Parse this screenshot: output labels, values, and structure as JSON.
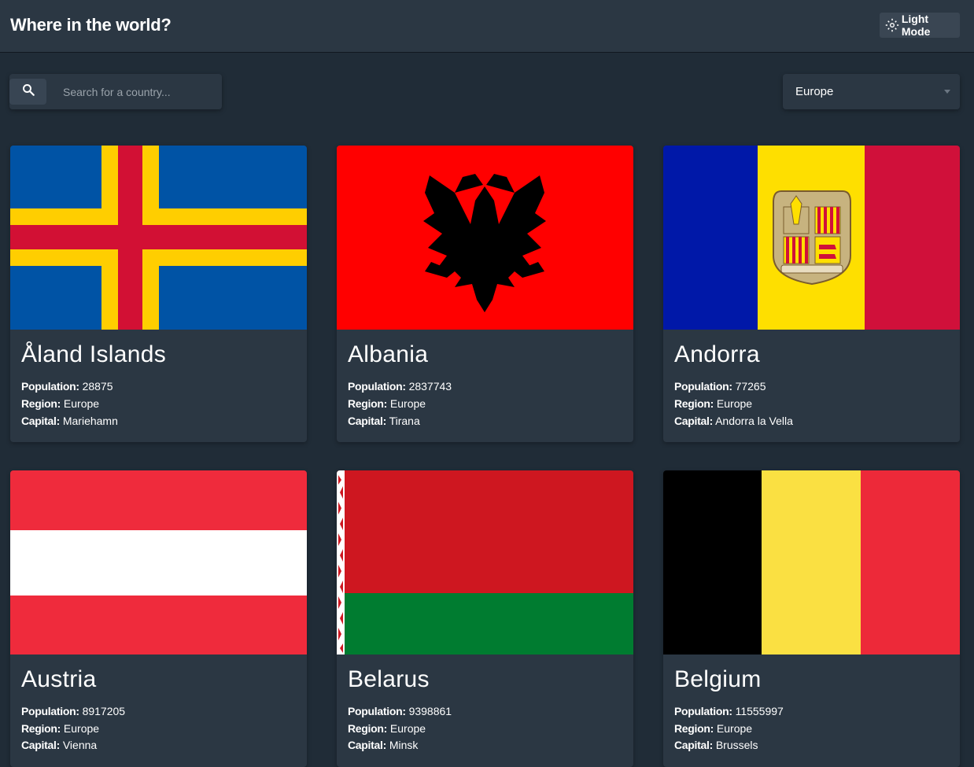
{
  "header": {
    "title": "Where in the world?",
    "mode_label": "Light Mode"
  },
  "search": {
    "placeholder": "Search for a country...",
    "value": ""
  },
  "filter": {
    "selected": "Europe"
  },
  "labels": {
    "population": "Population:",
    "region": "Region:",
    "capital": "Capital:"
  },
  "countries": [
    {
      "name": "Åland Islands",
      "population": "28875",
      "region": "Europe",
      "capital": "Mariehamn"
    },
    {
      "name": "Albania",
      "population": "2837743",
      "region": "Europe",
      "capital": "Tirana"
    },
    {
      "name": "Andorra",
      "population": "77265",
      "region": "Europe",
      "capital": "Andorra la Vella"
    },
    {
      "name": "Austria",
      "population": "8917205",
      "region": "Europe",
      "capital": "Vienna"
    },
    {
      "name": "Belarus",
      "population": "9398861",
      "region": "Europe",
      "capital": "Minsk"
    },
    {
      "name": "Belgium",
      "population": "11555997",
      "region": "Europe",
      "capital": "Brussels"
    }
  ],
  "flag_images": [
    "aland-flag",
    "albania-flag",
    "andorra-flag",
    "austria-flag",
    "belarus-flag",
    "belgium-flag"
  ],
  "colors": {
    "background": "#202c37",
    "element": "#2b3743",
    "text": "#ffffff"
  }
}
